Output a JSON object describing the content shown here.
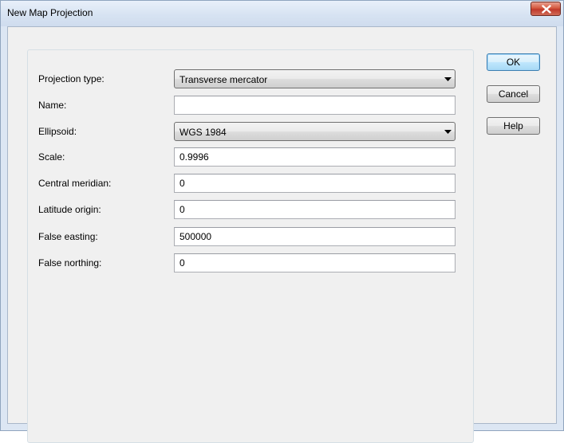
{
  "window": {
    "title": "New Map Projection"
  },
  "form": {
    "projection_type": {
      "label": "Projection type:",
      "value": "Transverse mercator"
    },
    "name": {
      "label": "Name:",
      "value": ""
    },
    "ellipsoid": {
      "label": "Ellipsoid:",
      "value": "WGS 1984"
    },
    "scale": {
      "label": "Scale:",
      "value": "0.9996"
    },
    "central_meridian": {
      "label": "Central meridian:",
      "value": "0"
    },
    "latitude_origin": {
      "label": "Latitude origin:",
      "value": "0"
    },
    "false_easting": {
      "label": "False easting:",
      "value": "500000"
    },
    "false_northing": {
      "label": "False northing:",
      "value": "0"
    }
  },
  "buttons": {
    "ok": "OK",
    "cancel": "Cancel",
    "help": "Help"
  },
  "icons": {
    "close": "close-icon",
    "dropdown": "chevron-down-icon"
  },
  "colors": {
    "close_button": "#c0392b",
    "default_button_border": "#3c7fb1"
  }
}
